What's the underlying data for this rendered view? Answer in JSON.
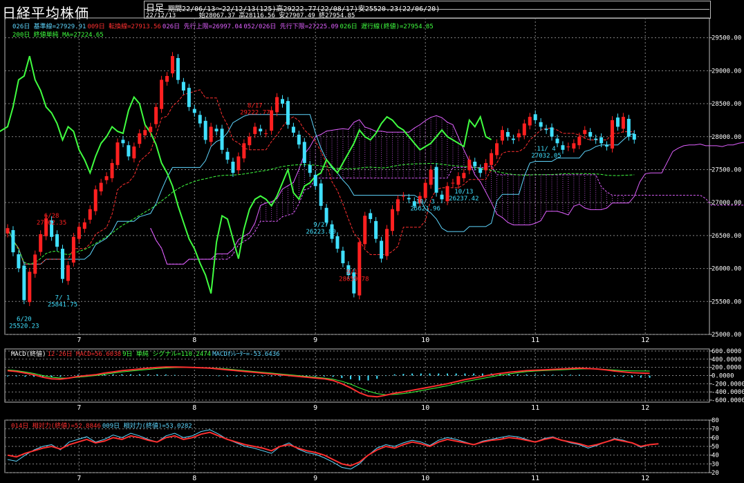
{
  "title": "日経平均株価",
  "header": {
    "period_type": "日足",
    "period": "期間22/06/13～22/12/13(125)高29222.77(22/08/17)安25520.23(22/06/20)",
    "date": "22/12/13",
    "ohlc": "始28067.37 高28116.56 安27907.49 終27954.85"
  },
  "legends": {
    "main_row1": [
      {
        "text": "026日 基準線=27929.91",
        "color": "#5fd7ff"
      },
      {
        "text": "009日 転換線=27913.56",
        "color": "#ff3030"
      },
      {
        "text": "026日 先行上限=26997.04",
        "color": "#e060ff"
      },
      {
        "text": "052/026日 先行下限=27225.09",
        "color": "#e060ff"
      },
      {
        "text": "026日 遅行線(終値)=27954.85",
        "color": "#40ff40"
      }
    ],
    "main_row2": [
      {
        "text": "200日 終値単純 MA=27224.65",
        "color": "#40ff40"
      }
    ],
    "macd": [
      {
        "text": "MACD(終値)",
        "color": "#ffffff"
      },
      {
        "text": "12-26日 MACD=56.6038",
        "color": "#ff3030"
      },
      {
        "text": "9日 単純 シグナル=110.2474",
        "color": "#40ff40"
      },
      {
        "text": "MACDｵｼﾚｰﾀｰ=-53.6436",
        "color": "#5fd7ff"
      }
    ],
    "rsi": [
      {
        "text": "014日 相対力(終値)=52.8846",
        "color": "#ff3030"
      },
      {
        "text": "009日 相対力(終値)=53.0282",
        "color": "#5fd7ff"
      }
    ]
  },
  "colors": {
    "up": "#ff2020",
    "down": "#40e0ff",
    "kijun": "#5fd7ff",
    "tenkan": "#ff3030",
    "cloud": "#e060ff",
    "chikou": "#40ff40",
    "ma": "#40ff40"
  },
  "chart_data": [
    {
      "type": "candlestick",
      "name": "price",
      "ylim": [
        25000,
        29800
      ],
      "y_ticks": [
        25000,
        25500,
        26000,
        26500,
        27000,
        27500,
        28000,
        28500,
        29000,
        29500
      ],
      "y_tick_labels": [
        "25000.00",
        "25500.00",
        "26000.00",
        "26500.00",
        "27000.00",
        "27500.00",
        "28000.00",
        "28500.00",
        "29000.00",
        "29500.00"
      ],
      "x_labels": [
        {
          "label": "7",
          "bar": 13
        },
        {
          "label": "8",
          "bar": 34
        },
        {
          "label": "9",
          "bar": 56
        },
        {
          "label": "10",
          "bar": 76
        },
        {
          "label": "11",
          "bar": 96
        },
        {
          "label": "12",
          "bar": 116
        }
      ],
      "closes": [
        26612,
        26246,
        26004,
        25520,
        25950,
        26212,
        26520,
        26762,
        26480,
        26330,
        25842,
        26050,
        26480,
        26632,
        26700,
        26900,
        27200,
        27300,
        27400,
        27600,
        27912,
        27900,
        27700,
        27850,
        28050,
        28100,
        28150,
        28450,
        28862,
        28920,
        29222,
        28860,
        28700,
        28450,
        28360,
        28200,
        27950,
        28150,
        28080,
        27800,
        27650,
        27450,
        27700,
        27900,
        28000,
        28150,
        28080,
        28050,
        28400,
        28600,
        28500,
        28180,
        28060,
        27880,
        27600,
        27450,
        27250,
        26950,
        26700,
        26450,
        26300,
        26080,
        25900,
        25622,
        26400,
        26800,
        26750,
        26450,
        26150,
        26600,
        26900,
        27050,
        27100,
        27050,
        26950,
        27100,
        27300,
        27500,
        27150,
        27050,
        27250,
        27300,
        27400,
        27450,
        27650,
        27550,
        27450,
        27600,
        27750,
        27900,
        28100,
        28000,
        27950,
        28050,
        28200,
        28300,
        28250,
        28150,
        28100,
        28000,
        27900,
        27800,
        27850,
        27900,
        28000,
        28100,
        28000,
        27950,
        27900,
        27850,
        28250,
        28150,
        28300,
        28000,
        27954
      ],
      "dates_labelled": [
        {
          "date": "6/20",
          "value": "25520.23",
          "bar": 3,
          "kind": "low"
        },
        {
          "date": "6/28",
          "value": "27062.35",
          "bar": 8,
          "kind": "high"
        },
        {
          "date": "7/ 1",
          "value": "25841.75",
          "bar": 10,
          "kind": "low"
        },
        {
          "date": "8/17",
          "value": "29222.77",
          "bar": 45,
          "kind": "high"
        },
        {
          "date": "9/13",
          "value": "28659.78",
          "bar": 63,
          "kind": "high"
        },
        {
          "date": "9/27",
          "value": "26223.80",
          "bar": 57,
          "kind": "low"
        },
        {
          "date": "10/ 3",
          "value": "25621.96",
          "bar": 76,
          "kind": "low"
        },
        {
          "date": "10/13",
          "value": "26237.42",
          "bar": 83,
          "kind": "low"
        },
        {
          "date": "11/ 4",
          "value": "27032.05",
          "bar": 98,
          "kind": "low"
        }
      ],
      "last": {
        "open": 28067.37,
        "high": 28116.56,
        "low": 27907.49,
        "close": 27954.85
      }
    },
    {
      "type": "line",
      "name": "macd",
      "ylim": [
        -650000,
        650000
      ],
      "y_ticks": [
        -600000,
        -400000,
        -200000,
        0,
        200000,
        400000,
        600000
      ],
      "y_tick_labels": [
        "-600.0000",
        "-400.0000",
        "-200.0000",
        "0.0000",
        "200.0000",
        "400.0000",
        "600.0000"
      ],
      "series": [
        {
          "name": "MACD",
          "values": [
            120,
            100,
            60,
            20,
            -40,
            -80,
            -90,
            -60,
            -20,
            0,
            20,
            60,
            90,
            120,
            140,
            160,
            180,
            200,
            210,
            210,
            205,
            200,
            190,
            180,
            160,
            140,
            120,
            100,
            80,
            60,
            40,
            20,
            0,
            -20,
            -40,
            -60,
            -80,
            -120,
            -200,
            -300,
            -420,
            -500,
            -520,
            -480,
            -430,
            -400,
            -360,
            -320,
            -280,
            -240,
            -200,
            -150,
            -100,
            -60,
            -20,
            20,
            50,
            80,
            100,
            120,
            130,
            140,
            150,
            160,
            170,
            180,
            170,
            160,
            140,
            110,
            90,
            70,
            60,
            56
          ]
        },
        {
          "name": "シグナル",
          "values": [
            140,
            120,
            90,
            50,
            0,
            -40,
            -60,
            -60,
            -40,
            -20,
            0,
            30,
            60,
            90,
            110,
            130,
            150,
            170,
            185,
            195,
            200,
            200,
            195,
            188,
            175,
            160,
            140,
            120,
            100,
            80,
            60,
            40,
            20,
            0,
            -20,
            -40,
            -60,
            -90,
            -140,
            -210,
            -300,
            -380,
            -440,
            -470,
            -460,
            -440,
            -410,
            -370,
            -330,
            -290,
            -250,
            -200,
            -150,
            -110,
            -70,
            -30,
            10,
            40,
            70,
            95,
            110,
            120,
            130,
            140,
            150,
            160,
            165,
            160,
            150,
            135,
            120,
            115,
            112,
            110
          ]
        },
        {
          "name": "MACDｵｼﾚｰﾀｰ",
          "values": [
            -20,
            -20,
            -30,
            -30,
            -40,
            -40,
            -30,
            0,
            20,
            20,
            20,
            30,
            30,
            30,
            30,
            30,
            30,
            30,
            25,
            15,
            5,
            0,
            -5,
            -8,
            -15,
            -20,
            -20,
            -20,
            -20,
            -20,
            -20,
            -20,
            -20,
            -20,
            -20,
            -20,
            -20,
            -30,
            -60,
            -90,
            -120,
            -120,
            -80,
            -10,
            30,
            40,
            50,
            50,
            50,
            50,
            50,
            50,
            50,
            50,
            50,
            50,
            40,
            40,
            30,
            25,
            20,
            20,
            20,
            20,
            20,
            20,
            5,
            0,
            -10,
            -25,
            -30,
            -45,
            -52,
            -54
          ]
        }
      ]
    },
    {
      "type": "line",
      "name": "rsi",
      "ylim": [
        20,
        80
      ],
      "y_ticks": [
        20,
        30,
        40,
        50,
        60,
        70,
        80
      ],
      "y_tick_labels": [
        "20",
        "30",
        "40",
        "50",
        "60",
        "70",
        "80"
      ],
      "series": [
        {
          "name": "014日",
          "values": [
            40,
            38,
            42,
            45,
            48,
            50,
            47,
            52,
            55,
            58,
            54,
            56,
            60,
            58,
            62,
            60,
            57,
            55,
            60,
            62,
            58,
            60,
            64,
            66,
            62,
            58,
            55,
            52,
            50,
            48,
            45,
            50,
            52,
            48,
            45,
            43,
            40,
            35,
            30,
            28,
            32,
            40,
            46,
            50,
            48,
            52,
            55,
            53,
            50,
            55,
            58,
            56,
            54,
            52,
            55,
            57,
            58,
            60,
            59,
            57,
            55,
            58,
            60,
            57,
            55,
            53,
            50,
            52,
            55,
            58,
            56,
            54,
            50,
            52,
            53
          ]
        },
        {
          "name": "009日",
          "values": [
            35,
            33,
            40,
            46,
            50,
            52,
            46,
            55,
            58,
            61,
            55,
            58,
            63,
            60,
            65,
            62,
            58,
            55,
            62,
            65,
            60,
            62,
            67,
            69,
            64,
            58,
            54,
            50,
            48,
            45,
            42,
            50,
            54,
            47,
            43,
            41,
            37,
            32,
            26,
            24,
            30,
            40,
            48,
            52,
            50,
            54,
            57,
            55,
            51,
            57,
            60,
            58,
            55,
            52,
            56,
            58,
            60,
            62,
            61,
            58,
            55,
            59,
            61,
            57,
            54,
            52,
            48,
            51,
            55,
            59,
            57,
            54,
            49,
            52,
            53
          ]
        }
      ]
    }
  ]
}
